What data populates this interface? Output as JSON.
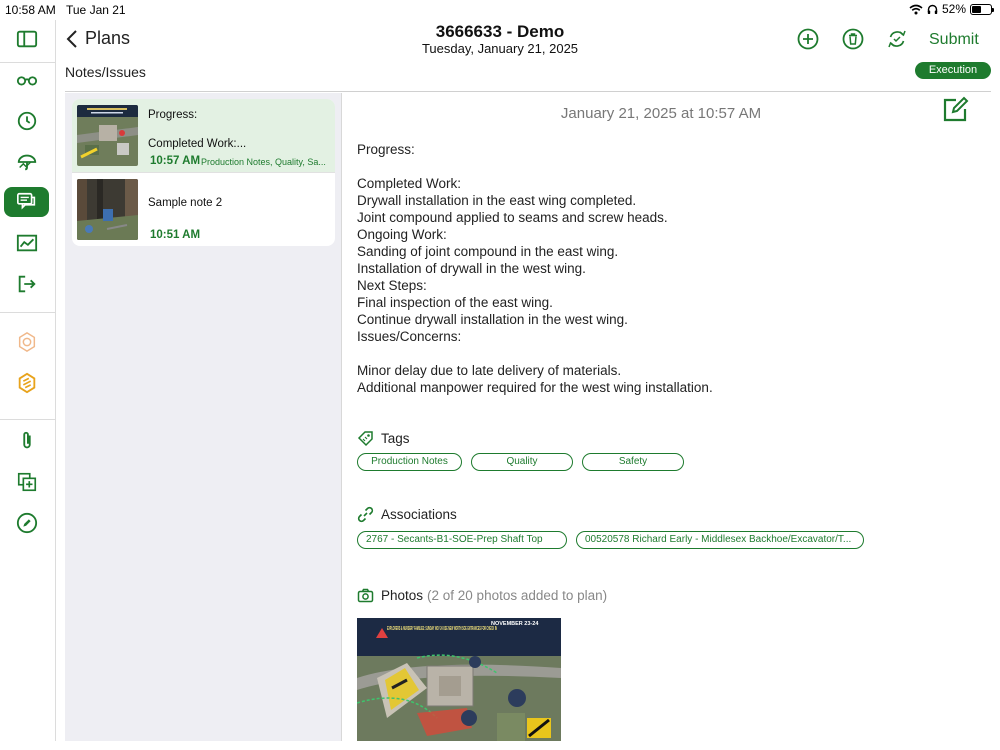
{
  "status": {
    "time": "10:58 AM",
    "date": "Tue Jan 21",
    "battery": "52%",
    "battery_level": 0.52
  },
  "header": {
    "back_label": "Plans",
    "title": "3666633 - Demo",
    "subtitle": "Tuesday, January 21, 2025",
    "submit_label": "Submit",
    "section_title": "Notes/Issues",
    "badge": "Execution"
  },
  "icons": {
    "rail": [
      "sidebar-toggle-icon",
      "glasses-icon",
      "clock-icon",
      "weather-icon",
      "notes-icon",
      "chart-icon",
      "logout-icon",
      "badge-icon",
      "logo-icon",
      "paperclip-icon",
      "add-copy-icon",
      "pencil-icon"
    ],
    "header": [
      "add-icon",
      "delete-icon",
      "sync-icon"
    ]
  },
  "colors": {
    "accent": "#1e7b2e",
    "selected_row": "#e3f1e3",
    "list_bg": "#eeeef3"
  },
  "notes": [
    {
      "line1": "Progress:",
      "line2": "Completed Work:...",
      "time": "10:57 AM",
      "tags": "Production Notes, Quality, Sa..."
    },
    {
      "line1": "Sample note 2",
      "time": "10:51 AM"
    }
  ],
  "detail": {
    "timestamp": "January 21, 2025 at 10:57 AM",
    "body": [
      "Progress:",
      "",
      "Completed Work:",
      "Drywall installation in the east wing completed.",
      "Joint compound applied to seams and screw heads.",
      "Ongoing Work:",
      "Sanding of joint compound in the east wing.",
      "Installation of drywall in the west wing.",
      "Next Steps:",
      "Final inspection of the east wing.",
      "Continue drywall installation in the west wing.",
      "Issues/Concerns:",
      "",
      "Minor delay due to late delivery of materials.",
      "Additional manpower required for the west wing installation."
    ],
    "tags_label": "Tags",
    "tags": [
      "Production Notes",
      "Quality",
      "Safety"
    ],
    "associations_label": "Associations",
    "associations": [
      "2767  -  Secants-B1-SOE-Prep Shaft Top",
      "00520578 Richard Early - Middlesex Backhoe/Excavator/T..."
    ],
    "photos_label": "Photos",
    "photos_count": "(2 of 20 photos added to plan)",
    "photo_banner": "EXPLORERS & NURSERY FAMILIES: SUNDAY NOV 24 USE NEW NORTH SOE ENTRANCES FOR CHECK IN",
    "photo_date": "NOVEMBER 23-24"
  }
}
